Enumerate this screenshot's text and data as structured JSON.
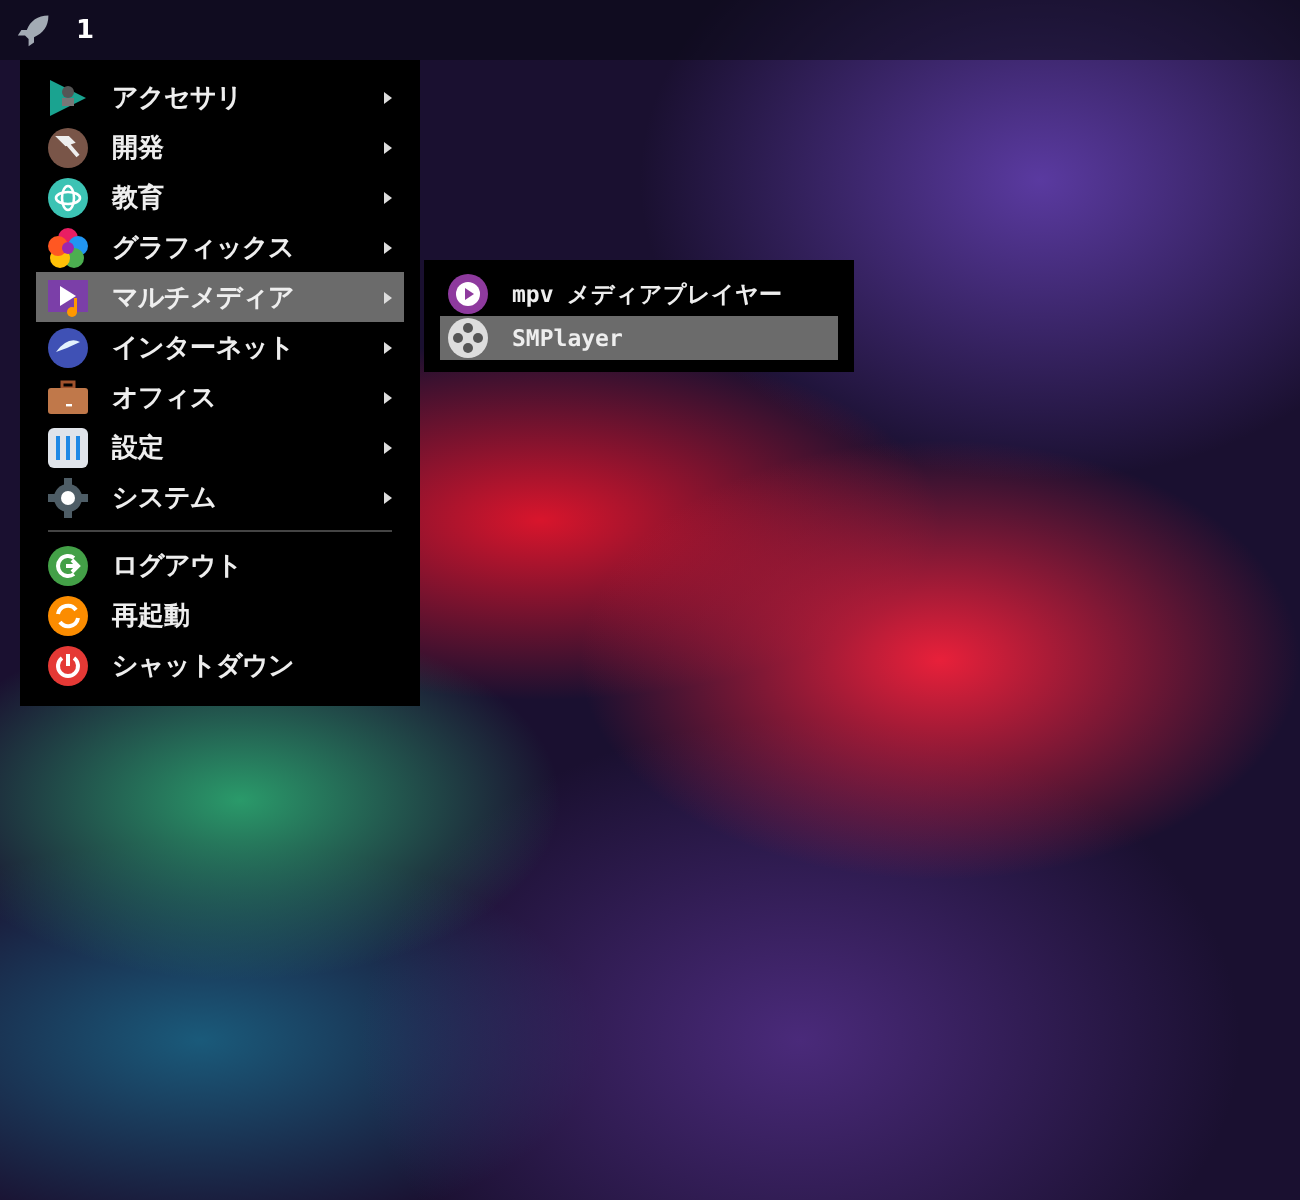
{
  "top_bar": {
    "workspace": "1"
  },
  "menu": {
    "sections": [
      [
        {
          "label": "アクセサリ",
          "submenu": true,
          "selected": false
        },
        {
          "label": "開発",
          "submenu": true,
          "selected": false
        },
        {
          "label": "教育",
          "submenu": true,
          "selected": false
        },
        {
          "label": "グラフィックス",
          "submenu": true,
          "selected": false
        },
        {
          "label": "マルチメディア",
          "submenu": true,
          "selected": true
        },
        {
          "label": "インターネット",
          "submenu": true,
          "selected": false
        },
        {
          "label": "オフィス",
          "submenu": true,
          "selected": false
        },
        {
          "label": "設定",
          "submenu": true,
          "selected": false
        },
        {
          "label": "システム",
          "submenu": true,
          "selected": false
        }
      ],
      [
        {
          "label": "ログアウト",
          "submenu": false,
          "selected": false
        },
        {
          "label": "再起動",
          "submenu": false,
          "selected": false
        },
        {
          "label": "シャットダウン",
          "submenu": false,
          "selected": false
        }
      ]
    ]
  },
  "submenu": {
    "items": [
      {
        "label": "mpv メディアプレイヤー",
        "selected": false
      },
      {
        "label": "SMPlayer",
        "selected": true
      }
    ]
  }
}
